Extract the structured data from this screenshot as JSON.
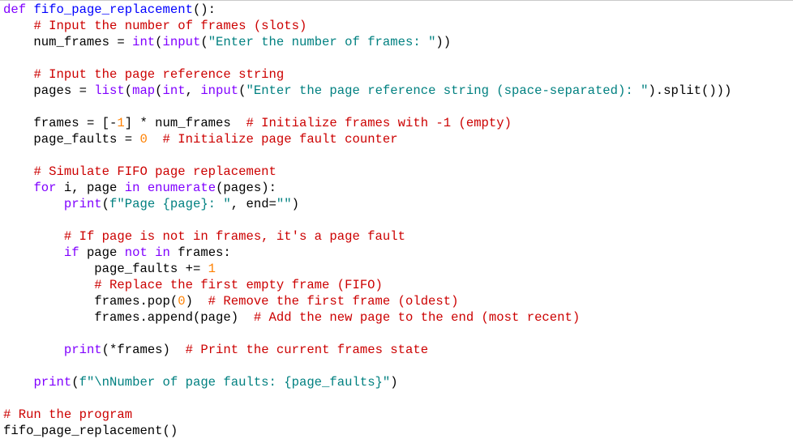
{
  "colors": {
    "background": "#ffffff",
    "keyword": "#8000ff",
    "function": "#0000ff",
    "builtin": "#8000ff",
    "comment": "#cc0000",
    "string": "#008080",
    "number": "#ff8000",
    "default": "#000000"
  },
  "code_lines": [
    [
      {
        "t": "kw",
        "v": "def"
      },
      {
        "t": "id",
        "v": " "
      },
      {
        "t": "fn",
        "v": "fifo_page_replacement"
      },
      {
        "t": "op",
        "v": "():"
      }
    ],
    [
      {
        "t": "id",
        "v": "    "
      },
      {
        "t": "cm",
        "v": "# Input the number of frames (slots)"
      }
    ],
    [
      {
        "t": "id",
        "v": "    num_frames "
      },
      {
        "t": "op",
        "v": "="
      },
      {
        "t": "id",
        "v": " "
      },
      {
        "t": "bi",
        "v": "int"
      },
      {
        "t": "op",
        "v": "("
      },
      {
        "t": "bi",
        "v": "input"
      },
      {
        "t": "op",
        "v": "("
      },
      {
        "t": "st",
        "v": "\"Enter the number of frames: \""
      },
      {
        "t": "op",
        "v": "))"
      }
    ],
    [],
    [
      {
        "t": "id",
        "v": "    "
      },
      {
        "t": "cm",
        "v": "# Input the page reference string"
      }
    ],
    [
      {
        "t": "id",
        "v": "    pages "
      },
      {
        "t": "op",
        "v": "="
      },
      {
        "t": "id",
        "v": " "
      },
      {
        "t": "bi",
        "v": "list"
      },
      {
        "t": "op",
        "v": "("
      },
      {
        "t": "bi",
        "v": "map"
      },
      {
        "t": "op",
        "v": "("
      },
      {
        "t": "bi",
        "v": "int"
      },
      {
        "t": "op",
        "v": ", "
      },
      {
        "t": "bi",
        "v": "input"
      },
      {
        "t": "op",
        "v": "("
      },
      {
        "t": "st",
        "v": "\"Enter the page reference string (space-separated): \""
      },
      {
        "t": "op",
        "v": ").split())"
      },
      {
        "t": "op",
        "v": ")"
      }
    ],
    [],
    [
      {
        "t": "id",
        "v": "    frames "
      },
      {
        "t": "op",
        "v": "= [-"
      },
      {
        "t": "nm",
        "v": "1"
      },
      {
        "t": "op",
        "v": "] *"
      },
      {
        "t": "id",
        "v": " num_frames  "
      },
      {
        "t": "cm",
        "v": "# Initialize frames with -1 (empty)"
      }
    ],
    [
      {
        "t": "id",
        "v": "    page_faults "
      },
      {
        "t": "op",
        "v": "="
      },
      {
        "t": "id",
        "v": " "
      },
      {
        "t": "nm",
        "v": "0"
      },
      {
        "t": "id",
        "v": "  "
      },
      {
        "t": "cm",
        "v": "# Initialize page fault counter"
      }
    ],
    [],
    [
      {
        "t": "id",
        "v": "    "
      },
      {
        "t": "cm",
        "v": "# Simulate FIFO page replacement"
      }
    ],
    [
      {
        "t": "id",
        "v": "    "
      },
      {
        "t": "kw",
        "v": "for"
      },
      {
        "t": "id",
        "v": " i, page "
      },
      {
        "t": "kw",
        "v": "in"
      },
      {
        "t": "id",
        "v": " "
      },
      {
        "t": "bi",
        "v": "enumerate"
      },
      {
        "t": "op",
        "v": "(pages):"
      }
    ],
    [
      {
        "t": "id",
        "v": "        "
      },
      {
        "t": "bi",
        "v": "print"
      },
      {
        "t": "op",
        "v": "("
      },
      {
        "t": "st",
        "v": "f\"Page {page}: \""
      },
      {
        "t": "op",
        "v": ", end="
      },
      {
        "t": "st",
        "v": "\"\""
      },
      {
        "t": "op",
        "v": ")"
      }
    ],
    [],
    [
      {
        "t": "id",
        "v": "        "
      },
      {
        "t": "cm",
        "v": "# If page is not in frames, it's a page fault"
      }
    ],
    [
      {
        "t": "id",
        "v": "        "
      },
      {
        "t": "kw",
        "v": "if"
      },
      {
        "t": "id",
        "v": " page "
      },
      {
        "t": "kw",
        "v": "not in"
      },
      {
        "t": "id",
        "v": " frames:"
      }
    ],
    [
      {
        "t": "id",
        "v": "            page_faults "
      },
      {
        "t": "op",
        "v": "+="
      },
      {
        "t": "id",
        "v": " "
      },
      {
        "t": "nm",
        "v": "1"
      }
    ],
    [
      {
        "t": "id",
        "v": "            "
      },
      {
        "t": "cm",
        "v": "# Replace the first empty frame (FIFO)"
      }
    ],
    [
      {
        "t": "id",
        "v": "            frames.pop"
      },
      {
        "t": "op",
        "v": "("
      },
      {
        "t": "nm",
        "v": "0"
      },
      {
        "t": "op",
        "v": ")"
      },
      {
        "t": "id",
        "v": "  "
      },
      {
        "t": "cm",
        "v": "# Remove the first frame (oldest)"
      }
    ],
    [
      {
        "t": "id",
        "v": "            frames.append"
      },
      {
        "t": "op",
        "v": "(page)"
      },
      {
        "t": "id",
        "v": "  "
      },
      {
        "t": "cm",
        "v": "# Add the new page to the end (most recent)"
      }
    ],
    [],
    [
      {
        "t": "id",
        "v": "        "
      },
      {
        "t": "bi",
        "v": "print"
      },
      {
        "t": "op",
        "v": "(*frames)"
      },
      {
        "t": "id",
        "v": "  "
      },
      {
        "t": "cm",
        "v": "# Print the current frames state"
      }
    ],
    [],
    [
      {
        "t": "id",
        "v": "    "
      },
      {
        "t": "bi",
        "v": "print"
      },
      {
        "t": "op",
        "v": "("
      },
      {
        "t": "st",
        "v": "f\"\\nNumber of page faults: {page_faults}\""
      },
      {
        "t": "op",
        "v": ")"
      }
    ],
    [],
    [
      {
        "t": "cm",
        "v": "# Run the program"
      }
    ],
    [
      {
        "t": "id",
        "v": "fifo_page_replacement"
      },
      {
        "t": "op",
        "v": "()"
      }
    ]
  ]
}
